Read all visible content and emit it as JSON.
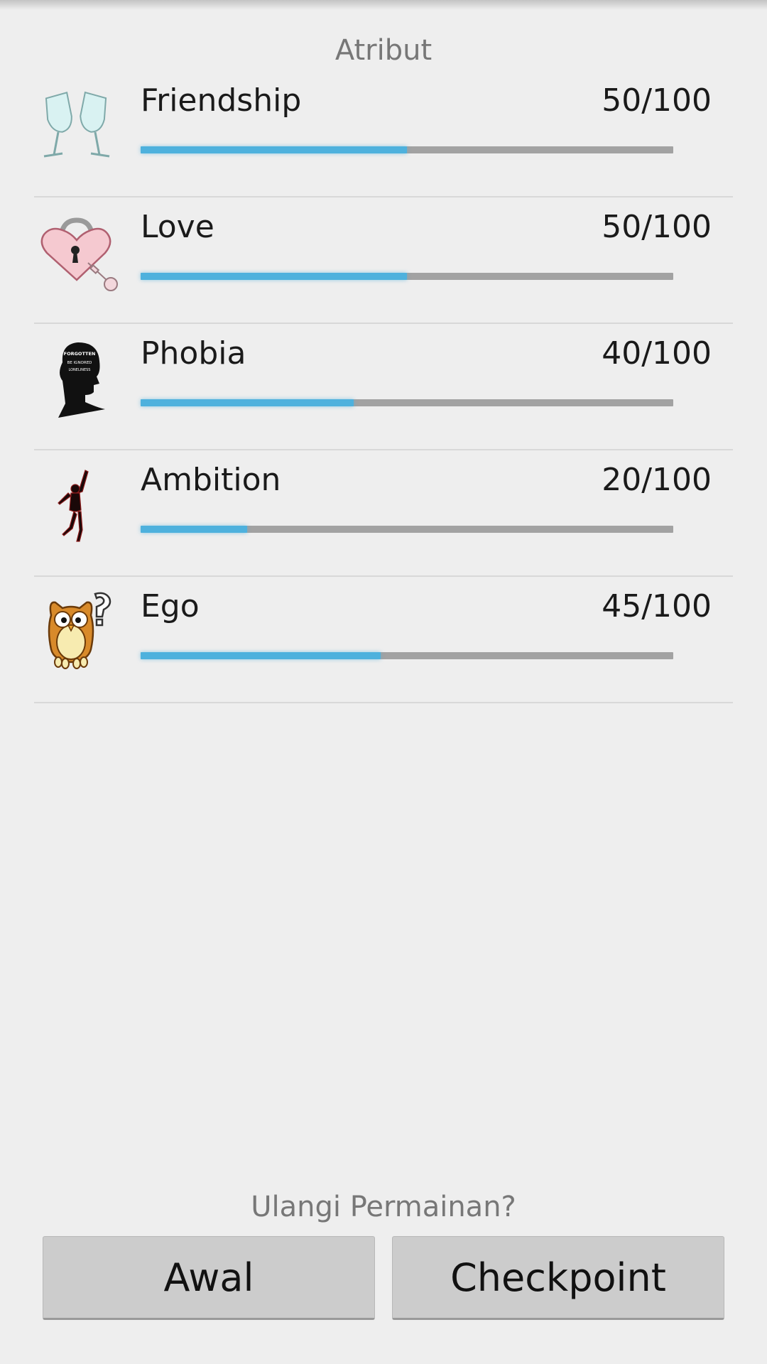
{
  "header": {
    "title": "Atribut"
  },
  "attributes": [
    {
      "name": "Friendship",
      "value": "50/100",
      "progress": 0.5,
      "icon": "toasting-glasses-icon"
    },
    {
      "name": "Love",
      "value": "50/100",
      "progress": 0.5,
      "icon": "heart-lock-icon"
    },
    {
      "name": "Phobia",
      "value": "40/100",
      "progress": 0.4,
      "icon": "head-silhouette-icon",
      "icon_text": [
        "FORGOTTEN",
        "BE IGNORED",
        "LONELINESS"
      ]
    },
    {
      "name": "Ambition",
      "value": "20/100",
      "progress": 0.2,
      "icon": "reaching-figure-icon"
    },
    {
      "name": "Ego",
      "value": "45/100",
      "progress": 0.45,
      "icon": "owl-question-icon"
    }
  ],
  "footer": {
    "prompt": "Ulangi Permainan?",
    "buttons": {
      "awal": "Awal",
      "checkpoint": "Checkpoint"
    }
  },
  "colors": {
    "background": "#eeeeee",
    "bar_fill": "#4eb1dd",
    "bar_track": "#a2a2a2",
    "button": "#cccccc"
  }
}
